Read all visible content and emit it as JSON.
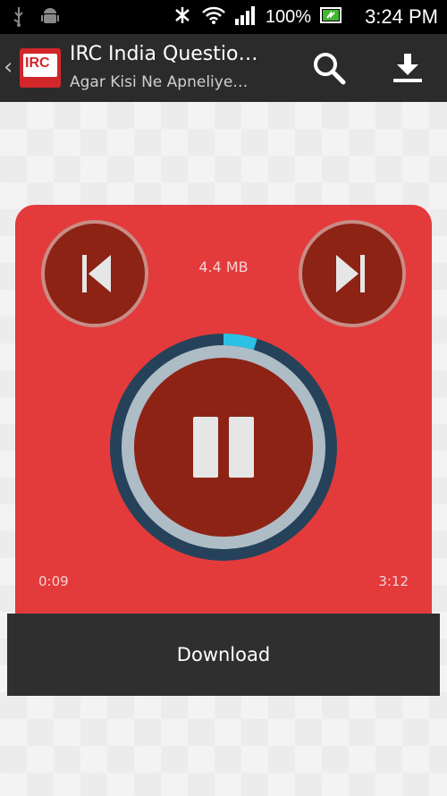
{
  "status_bar": {
    "battery": "100%",
    "time": "3:24 PM"
  },
  "action_bar": {
    "title": "IRC India Questio…",
    "subtitle": "Agar Kisi Ne Apneliye…",
    "logo_text": "IRC"
  },
  "player": {
    "file_size": "4.4 MB",
    "elapsed": "0:09",
    "total": "3:12",
    "progress": 0.048
  },
  "download_label": "Download",
  "colors": {
    "card": "#e33a3c",
    "button": "#8d2315",
    "ring_track": "#25425a",
    "ring_progress": "#2bc1e4",
    "action_bar": "#2b2b2b"
  },
  "icons": {
    "back": "chevron-left-icon",
    "search": "search-icon",
    "download": "download-icon",
    "prev": "skip-previous-icon",
    "next": "skip-next-icon",
    "pause": "pause-icon"
  }
}
